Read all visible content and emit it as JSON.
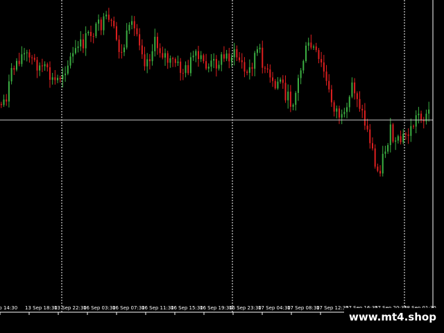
{
  "chart_data": {
    "type": "candlestick",
    "background": "#000000",
    "up_color": "#3cb043",
    "down_color": "#e02020",
    "grid": "vertical dotted",
    "grid_color": "#ffffff",
    "horizontal_line": true,
    "horizontal_line_color": "#c8c8c8",
    "x_tick_labels": [
      "ep 14:30",
      "13 Sep 18:30",
      "13 Sep 22:30",
      "16 Sep 03:30",
      "16 Sep 07:30",
      "16 Sep 11:30",
      "16 Sep 15:30",
      "16 Sep 19:30",
      "16 Sep 23:30",
      "17 Sep 04:30",
      "17 Sep 08:30",
      "17 Sep 12:30",
      "17 Sep 16:30",
      "17 Sep 20:30",
      "18 Sep 01:30"
    ],
    "trend_closes": [
      150,
      140,
      110,
      90,
      80,
      78,
      85,
      90,
      95,
      100,
      110,
      118,
      112,
      100,
      90,
      78,
      70,
      62,
      52,
      45,
      40,
      35,
      30,
      38,
      58,
      80,
      55,
      40,
      45,
      60,
      90,
      78,
      62,
      70,
      78,
      92,
      88,
      98,
      104,
      96,
      82,
      86,
      90,
      96,
      92,
      88,
      84,
      80,
      78,
      80,
      90,
      110,
      95,
      72,
      80,
      100,
      118,
      128,
      110,
      132,
      148,
      140,
      110,
      80,
      66,
      70,
      88,
      98,
      130,
      150,
      160,
      175,
      165,
      120,
      135,
      160,
      185,
      205,
      250,
      238,
      212,
      190,
      210,
      205,
      195,
      190,
      175,
      160,
      172,
      162
    ]
  },
  "watermark": "www.mt4.shop"
}
